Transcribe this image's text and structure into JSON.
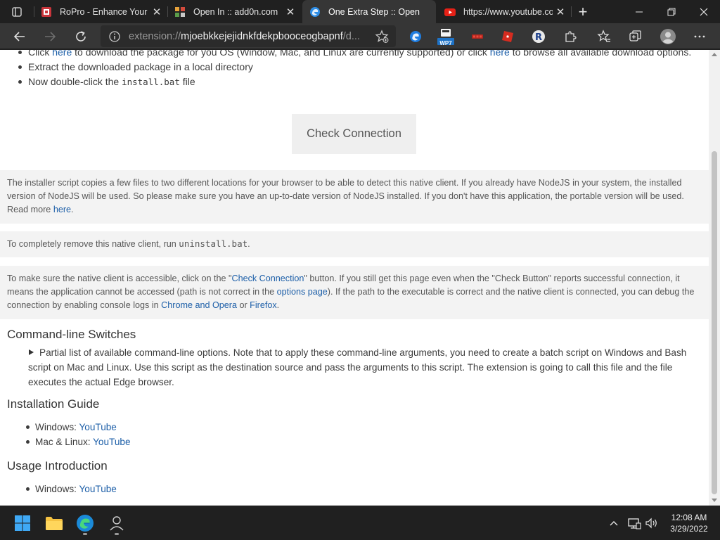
{
  "browser": {
    "tabs": [
      {
        "title": "RoPro - Enhance Your R",
        "icon": "ropro-icon",
        "active": false
      },
      {
        "title": "Open In :: add0n.com",
        "icon": "add0n-icon",
        "active": false
      },
      {
        "title": "One Extra Step :: Open",
        "icon": "edge-icon",
        "active": true
      },
      {
        "title": "https://www.youtube.co",
        "icon": "youtube-icon",
        "active": false
      }
    ],
    "address": {
      "scheme": "extension://",
      "host": "mjoebkkejejidnkfdekpbooceogbapnf",
      "path": "/d..."
    },
    "extensions": [
      "edge-ext-icon",
      "wp7-ext-icon",
      "red-ext-icon",
      "roblox-ext-icon",
      "ropro-ext-icon",
      "puzzle-icon"
    ],
    "extension_badge": "WP7"
  },
  "page": {
    "steps": {
      "s1": {
        "pre": "Click ",
        "link1": "here",
        "mid": " to download the package for you OS (Window, Mac, and Linux are currently supported) or click ",
        "link2": "here",
        "post": " to browse all available download options."
      },
      "s2": "Extract the downloaded package in a local directory",
      "s3": {
        "pre": "Now double-click the ",
        "code": "install.bat",
        "post": " file"
      }
    },
    "check_button": "Check Connection",
    "note1": {
      "text": "The installer script copies a few files to two different locations for your browser to be able to detect this native client. If you already have NodeJS in your system, the installed version of NodeJS will be used. So please make sure you have an up-to-date version of NodeJS installed. If you don't have this application, the portable version will be used. Read more ",
      "link": "here",
      "end": "."
    },
    "note2": {
      "pre": "To completely remove this native client, run ",
      "code": "uninstall.bat",
      "post": "."
    },
    "note3": {
      "a": "To make sure the native client is accessible, click on the \"",
      "link1": "Check Connection",
      "b": "\" button. If you still get this page even when the \"Check Button\" reports successful connection, it means the application cannot be accessed (path is not correct in the ",
      "link2": "options page",
      "c": "). If the path to the executable is correct and the native client is connected, you can debug the connection by enabling console logs in ",
      "link3": "Chrome and Opera",
      "d": " or ",
      "link4": "Firefox",
      "e": "."
    },
    "switches_heading": "Command-line Switches",
    "switches_summary": "Partial list of available command-line options. Note that to apply these command-line arguments, you need to create a batch script on Windows and Bash script on Mac and Linux. Use this script as the destination source and pass the arguments to this script. The extension is going to call this file and the file executes the actual Edge browser.",
    "install_heading": "Installation Guide",
    "install_items": [
      {
        "label": "Windows: ",
        "link": "YouTube"
      },
      {
        "label": "Mac & Linux: ",
        "link": "YouTube"
      }
    ],
    "usage_heading": "Usage Introduction",
    "usage_items": [
      {
        "label": "Windows: ",
        "link": "YouTube"
      }
    ]
  },
  "taskbar": {
    "apps": [
      "windows-start-icon",
      "file-explorer-icon",
      "edge-browser-icon",
      "user-app-icon"
    ],
    "time": "12:08 AM",
    "date": "3/29/2022"
  },
  "colors": {
    "link": "#1d5fa8",
    "note_bg": "#f3f3f3",
    "chrome_dark": "#202020",
    "toolbar": "#363636"
  }
}
